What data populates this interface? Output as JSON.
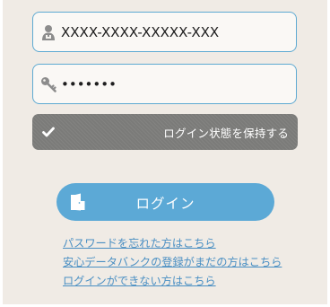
{
  "login_form": {
    "username": {
      "value": "XXXX-XXXX-XXXXX-XXX",
      "icon": "user-icon"
    },
    "password": {
      "value": "•••••••",
      "icon": "key-icon"
    },
    "keep_logged_in": {
      "label": "ログイン状態を保持する",
      "checked": true,
      "icon": "checkmark-icon"
    },
    "login_button": {
      "label": "ログイン",
      "icon": "door-icon"
    }
  },
  "links": [
    {
      "label": "パスワードを忘れた方はこちら"
    },
    {
      "label": "安心データバンクの登録がまだの方はこちら"
    },
    {
      "label": "ログインができない方はこちら"
    }
  ],
  "colors": {
    "panel_background": "#f0ebe5",
    "field_border": "#5eaad2",
    "keep_toggle": "#7b7b79",
    "login_button": "#5ca9d6",
    "link": "#4a8fc3"
  }
}
